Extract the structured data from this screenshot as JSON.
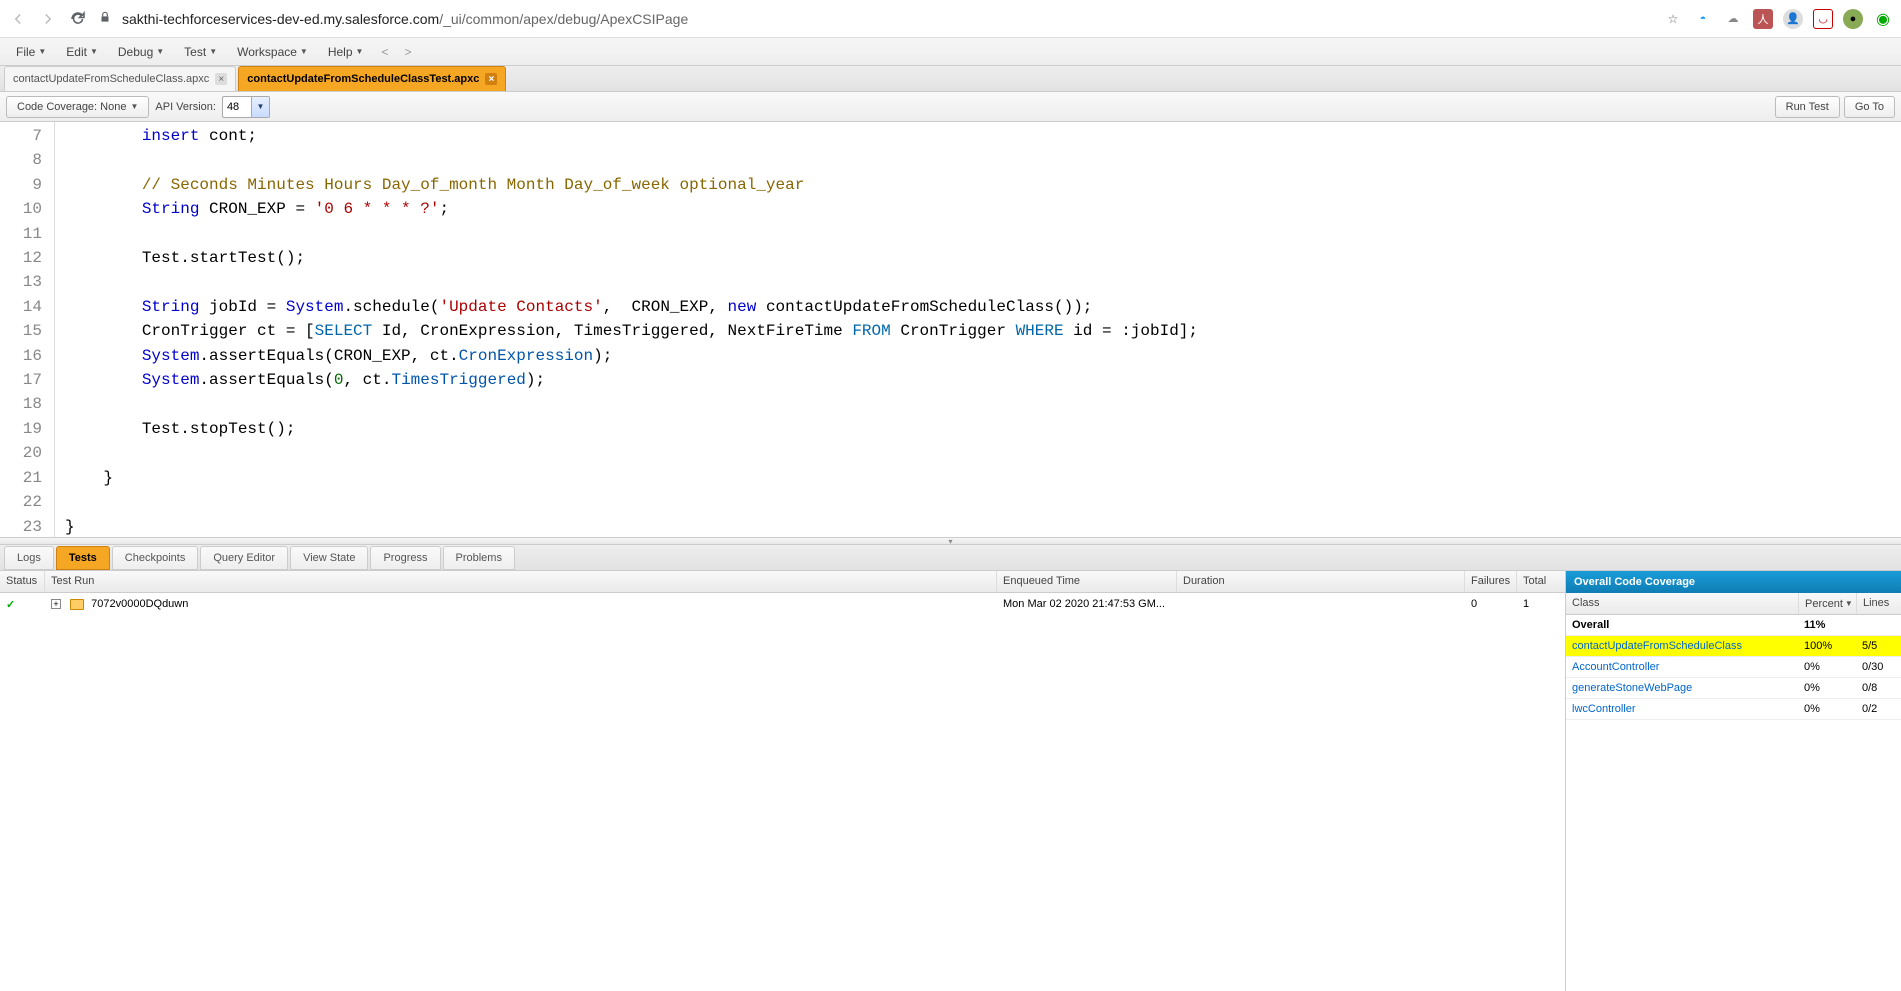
{
  "browser": {
    "url_domain": "sakthi-techforceservices-dev-ed.my.salesforce.com",
    "url_path": "/_ui/common/apex/debug/ApexCSIPage"
  },
  "menu": {
    "file": "File",
    "edit": "Edit",
    "debug": "Debug",
    "test": "Test",
    "workspace": "Workspace",
    "help": "Help",
    "back": "<",
    "forward": ">"
  },
  "file_tabs": {
    "tab1": "contactUpdateFromScheduleClass.apxc",
    "tab2": "contactUpdateFromScheduleClassTest.apxc"
  },
  "toolbar": {
    "coverage": "Code Coverage: None",
    "api_label": "API Version:",
    "api_value": "48",
    "run_test": "Run Test",
    "go_to": "Go To"
  },
  "code": {
    "lines": [
      "7",
      "8",
      "9",
      "10",
      "11",
      "12",
      "13",
      "14",
      "15",
      "16",
      "17",
      "18",
      "19",
      "20",
      "21",
      "22",
      "23"
    ]
  },
  "bottom_tabs": {
    "logs": "Logs",
    "tests": "Tests",
    "checkpoints": "Checkpoints",
    "query": "Query Editor",
    "view_state": "View State",
    "progress": "Progress",
    "problems": "Problems"
  },
  "test_headers": {
    "status": "Status",
    "run": "Test Run",
    "time": "Enqueued Time",
    "dur": "Duration",
    "fail": "Failures",
    "total": "Total"
  },
  "test_row": {
    "id": "7072v0000DQduwn",
    "time": "Mon Mar 02 2020 21:47:53 GM...",
    "fail": "0",
    "total": "1"
  },
  "coverage": {
    "title": "Overall Code Coverage",
    "h_class": "Class",
    "h_pct": "Percent",
    "h_lines": "Lines",
    "rows": {
      "overall": {
        "class": "Overall",
        "pct": "11%",
        "lines": ""
      },
      "r1": {
        "class": "contactUpdateFromScheduleClass",
        "pct": "100%",
        "lines": "5/5"
      },
      "r2": {
        "class": "AccountController",
        "pct": "0%",
        "lines": "0/30"
      },
      "r3": {
        "class": "generateStoneWebPage",
        "pct": "0%",
        "lines": "0/8"
      },
      "r4": {
        "class": "lwcController",
        "pct": "0%",
        "lines": "0/2"
      }
    }
  }
}
